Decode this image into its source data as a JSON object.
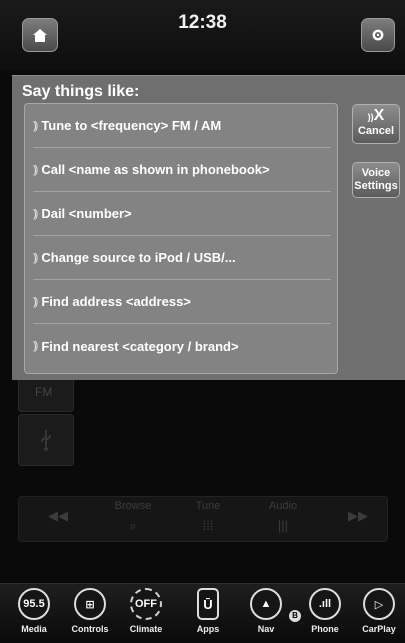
{
  "status": {
    "time": "12:38"
  },
  "topbar": {
    "home_icon": "home-icon",
    "settings_icon": "gear-icon"
  },
  "background_media": {
    "fm_label": "FM",
    "usb_icon": "usb-icon",
    "controls": [
      {
        "label": "",
        "icon": "◀◀"
      },
      {
        "label": "Browse",
        "icon": "⌕"
      },
      {
        "label": "Tune",
        "icon": "⁞⁞⁞"
      },
      {
        "label": "Audio",
        "icon": "|||"
      },
      {
        "label": "",
        "icon": "▶▶"
      }
    ]
  },
  "voice": {
    "title": "Say things like:",
    "mic_glyph": "))",
    "phrases": [
      "Tune to <frequency> FM / AM",
      "Call <name as shown in phonebook>",
      "Dail <number>",
      "Change source to iPod / USB/...",
      "Find address <address>",
      "Find nearest <category / brand>"
    ],
    "cancel": {
      "icon": "))",
      "x": "X",
      "label": "Cancel"
    },
    "voice_settings": {
      "line1": "Voice",
      "line2": "Settings"
    }
  },
  "nav": {
    "items": [
      {
        "key": "media",
        "display": "95.5",
        "label": "Media"
      },
      {
        "key": "controls",
        "display": "⊞",
        "label": "Controls"
      },
      {
        "key": "climate",
        "display": "OFF",
        "label": "Climate"
      },
      {
        "key": "apps",
        "display": "Ū",
        "label": "Apps"
      },
      {
        "key": "nav",
        "display": "▲",
        "label": "Nav"
      },
      {
        "key": "phone",
        "display": ".ıll",
        "label": "Phone"
      },
      {
        "key": "carplay",
        "display": "▷",
        "label": "CarPlay"
      }
    ],
    "bluetooth_badge": "B"
  }
}
